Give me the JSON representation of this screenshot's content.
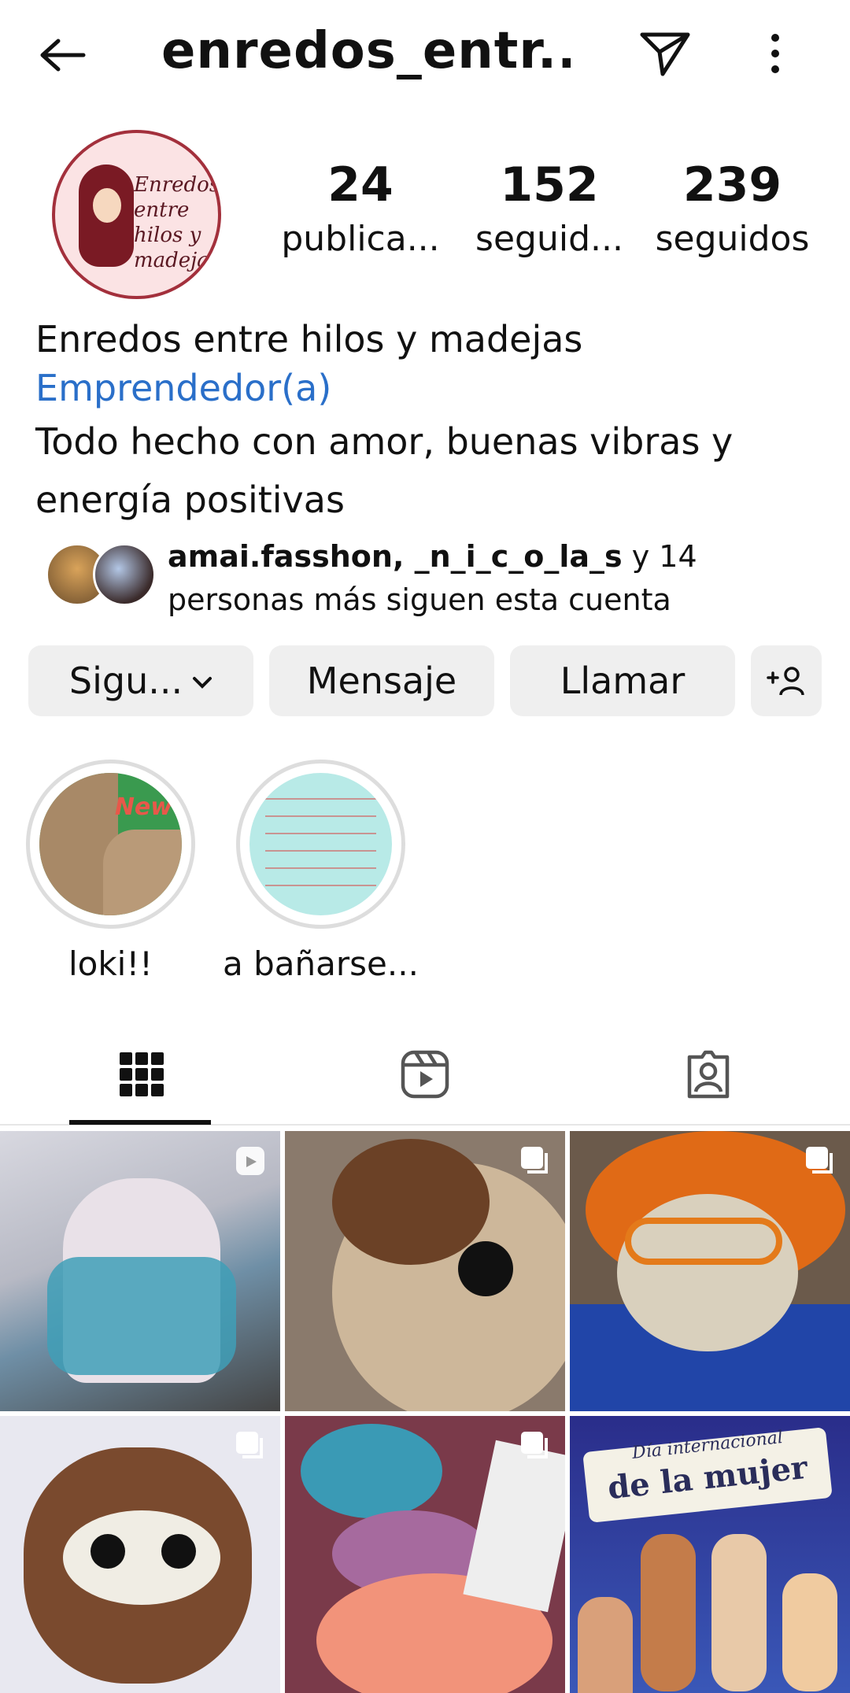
{
  "header": {
    "username": "enredos_entr...",
    "icons": [
      "back-arrow-icon",
      "send-icon",
      "more-vertical-icon"
    ]
  },
  "profile": {
    "avatar_logo_text": "Enredos entre hilos y madejas",
    "stats": [
      {
        "value": "24",
        "label": "publica..."
      },
      {
        "value": "152",
        "label": "seguid..."
      },
      {
        "value": "239",
        "label": "seguidos"
      }
    ],
    "name": "Enredos entre hilos y madejas",
    "category": "Emprendedor(a)",
    "bio_line1": "Todo hecho con amor, buenas vibras y",
    "bio_line2": "energía positivas",
    "followed_by_names": "amai.fasshon, _n_i_c_o_la_s",
    "followed_by_more": " y 14",
    "followed_by_suffix": "personas más siguen esta cuenta"
  },
  "buttons": {
    "following": "Sigu...",
    "message": "Mensaje",
    "call": "Llamar"
  },
  "highlights": [
    {
      "label": "loki!!",
      "thumb_text": "New"
    },
    {
      "label": "a bañarse..."
    }
  ],
  "tabs": [
    "grid-icon",
    "reels-icon",
    "tagged-icon"
  ],
  "grid": {
    "post_6_title_small": "Día internacional",
    "post_6_title_big": "de la mujer"
  },
  "colors": {
    "accent_link": "#2a6fc9",
    "button_bg": "#efefef"
  }
}
